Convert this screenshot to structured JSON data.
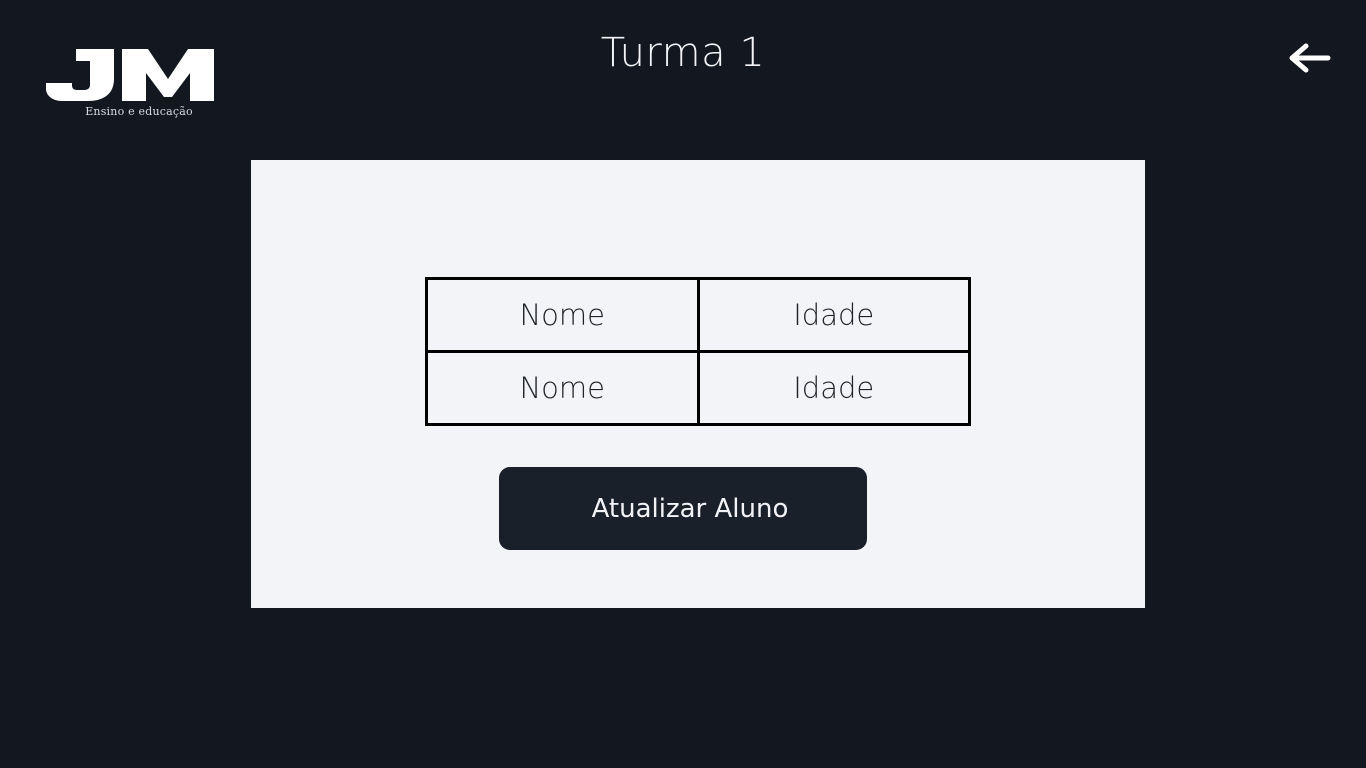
{
  "brand": {
    "logo_text": "JM",
    "tagline": "Ensino e educação"
  },
  "header": {
    "title": "Turma 1",
    "back_icon": "arrow-left-icon"
  },
  "table": {
    "columns": [
      "Nome",
      "Idade"
    ],
    "rows": [
      [
        "Nome",
        "Idade"
      ]
    ]
  },
  "actions": {
    "update_label": "Atualizar Aluno"
  },
  "colors": {
    "background": "#131720",
    "card": "#f3f4f8",
    "button": "#19202a",
    "text_light": "#f2f3f6"
  }
}
